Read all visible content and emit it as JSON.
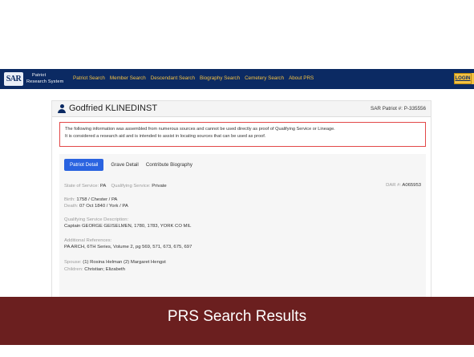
{
  "navbar": {
    "logo_text": "SAR",
    "brand_line1": "Patriot",
    "brand_line2": "Research System",
    "links": [
      "Patriot Search",
      "Member Search",
      "Descendant Search",
      "Biography Search",
      "Cemetery Search",
      "About PRS"
    ],
    "login_label": "LOGIN",
    "colors": {
      "bar": "#0b2a63",
      "link": "#f5c242"
    }
  },
  "patriot": {
    "name": "Godfried KLINEDINST",
    "number_label": "SAR Patriot #:",
    "number": "P-335556"
  },
  "notice": {
    "line1": "The following information was assembled from numerous sources and cannot be used directly as proof of Qualifying Service or Lineage.",
    "line2": "It is considered a research aid and is intended to assist in locating sources that can be used as proof.",
    "border_color": "#e24848"
  },
  "tabs": [
    {
      "label": "Patriot Detail",
      "active": true
    },
    {
      "label": "Grave Detail",
      "active": false
    },
    {
      "label": "Contribute Biography",
      "active": false
    }
  ],
  "details": {
    "state_label": "State of Service:",
    "state_value": "PA",
    "qualifying_label": "Qualifying Service:",
    "qualifying_value": "Private",
    "dar_label": "DAR #:",
    "dar_value": "A065953",
    "birth_label": "Birth:",
    "birth_value": "1758 / Chester / PA",
    "death_label": "Death:",
    "death_value": "07 Oct 1840 / York / PA",
    "service_desc_label": "Qualifying Service Description:",
    "service_desc_value": "Captain GEORGE GEISELMEN, 1780, 1783, YORK CO MIL",
    "references_label": "Additional References:",
    "references_value": "PA ARCH, 6TH Series, Volume 2, pg 569, 571, 673, 675, 697",
    "spouse_label": "Spouse:",
    "spouse_value": "(1) Rosina Helman (2) Margaret Hengst",
    "children_label": "Children:",
    "children_value": "Christian; Elizabeth"
  },
  "caption": {
    "text": "PRS Search Results",
    "color": "#6b1f1f"
  }
}
